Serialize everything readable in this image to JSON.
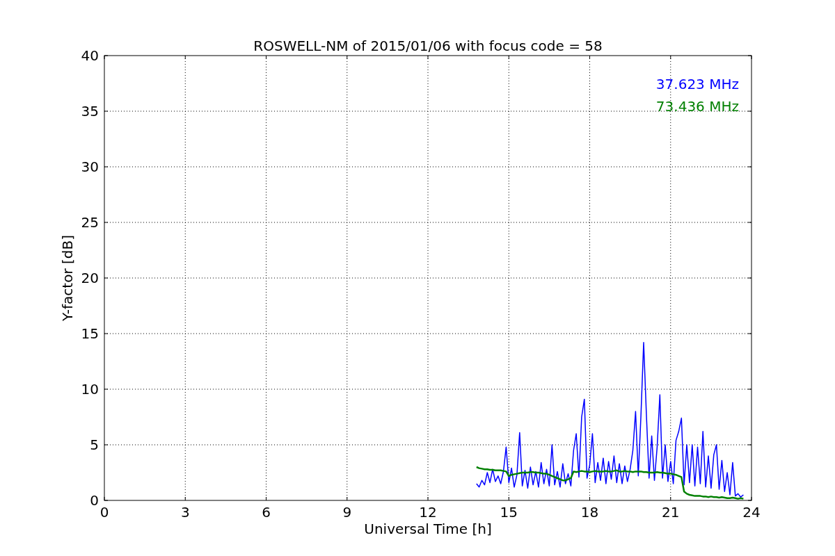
{
  "figure": {
    "chart_data": {
      "type": "line",
      "title": "ROSWELL-NM of 2015/01/06 with focus code = 58",
      "xlabel": "Universal Time [h]",
      "ylabel": "Y-factor [dB]",
      "x": [
        13.8,
        13.9,
        14.0,
        14.1,
        14.2,
        14.3,
        14.4,
        14.5,
        14.6,
        14.7,
        14.8,
        14.9,
        15.0,
        15.1,
        15.2,
        15.3,
        15.4,
        15.5,
        15.6,
        15.7,
        15.8,
        15.9,
        16.0,
        16.1,
        16.2,
        16.3,
        16.4,
        16.5,
        16.6,
        16.7,
        16.8,
        16.9,
        17.0,
        17.1,
        17.2,
        17.3,
        17.4,
        17.5,
        17.6,
        17.7,
        17.8,
        17.9,
        18.0,
        18.1,
        18.2,
        18.3,
        18.4,
        18.5,
        18.6,
        18.7,
        18.8,
        18.9,
        19.0,
        19.1,
        19.2,
        19.3,
        19.4,
        19.5,
        19.6,
        19.7,
        19.8,
        19.9,
        20.0,
        20.1,
        20.2,
        20.3,
        20.4,
        20.5,
        20.6,
        20.7,
        20.8,
        20.9,
        21.0,
        21.1,
        21.2,
        21.3,
        21.4,
        21.5,
        21.6,
        21.7,
        21.8,
        21.9,
        22.0,
        22.1,
        22.2,
        22.3,
        22.4,
        22.5,
        22.6,
        22.7,
        22.8,
        22.9,
        23.0,
        23.1,
        23.2,
        23.3,
        23.4,
        23.5,
        23.6,
        23.7
      ],
      "series": [
        {
          "name": "37.623 MHz",
          "color": "#0000ff",
          "values": [
            1.5,
            1.2,
            1.8,
            1.4,
            2.5,
            1.6,
            2.8,
            1.7,
            2.2,
            1.5,
            2.6,
            4.8,
            1.6,
            2.9,
            1.2,
            2.3,
            6.1,
            1.3,
            2.7,
            1.1,
            3.0,
            1.4,
            2.6,
            1.2,
            3.4,
            1.5,
            2.8,
            1.3,
            5.0,
            1.4,
            2.6,
            1.2,
            3.3,
            1.5,
            2.4,
            1.3,
            4.5,
            6.0,
            2.1,
            7.5,
            9.1,
            2.0,
            3.2,
            6.0,
            1.6,
            3.4,
            1.8,
            3.8,
            1.5,
            3.5,
            1.9,
            4.0,
            1.6,
            3.3,
            1.5,
            3.1,
            1.7,
            2.8,
            4.5,
            8.0,
            2.2,
            7.6,
            14.2,
            7.8,
            2.0,
            5.8,
            1.8,
            4.8,
            9.5,
            2.0,
            5.0,
            1.7,
            3.5,
            1.5,
            5.4,
            6.2,
            7.4,
            1.4,
            5.0,
            1.6,
            5.0,
            1.3,
            4.8,
            1.5,
            6.2,
            1.2,
            4.0,
            1.1,
            4.1,
            5.0,
            1.0,
            3.6,
            0.8,
            2.5,
            0.5,
            3.4,
            0.4,
            0.6,
            0.3,
            0.5
          ]
        },
        {
          "name": "73.436 MHz",
          "color": "#008000",
          "values": [
            3.0,
            2.9,
            2.85,
            2.8,
            2.8,
            2.75,
            2.75,
            2.7,
            2.7,
            2.7,
            2.65,
            2.6,
            2.2,
            2.3,
            2.35,
            2.4,
            2.45,
            2.5,
            2.5,
            2.5,
            2.55,
            2.55,
            2.5,
            2.5,
            2.45,
            2.4,
            2.4,
            2.3,
            2.2,
            2.1,
            2.0,
            1.9,
            1.8,
            1.8,
            1.9,
            2.0,
            2.6,
            2.55,
            2.6,
            2.65,
            2.6,
            2.6,
            2.55,
            2.6,
            2.65,
            2.6,
            2.6,
            2.6,
            2.65,
            2.6,
            2.6,
            2.65,
            2.7,
            2.6,
            2.6,
            2.65,
            2.6,
            2.6,
            2.55,
            2.6,
            2.6,
            2.6,
            2.55,
            2.55,
            2.5,
            2.5,
            2.5,
            2.55,
            2.5,
            2.5,
            2.45,
            2.4,
            2.4,
            2.35,
            2.3,
            2.2,
            2.1,
            0.8,
            0.6,
            0.5,
            0.45,
            0.4,
            0.4,
            0.4,
            0.35,
            0.35,
            0.3,
            0.35,
            0.3,
            0.3,
            0.25,
            0.3,
            0.25,
            0.2,
            0.2,
            0.25,
            0.2,
            0.15,
            0.2,
            0.15
          ]
        }
      ],
      "xlim": [
        0,
        24
      ],
      "ylim": [
        0,
        40
      ],
      "grid": true,
      "xticks": [
        0,
        3,
        6,
        9,
        12,
        15,
        18,
        21,
        24
      ],
      "yticks": [
        0,
        5,
        10,
        15,
        20,
        25,
        30,
        35,
        40
      ]
    }
  }
}
